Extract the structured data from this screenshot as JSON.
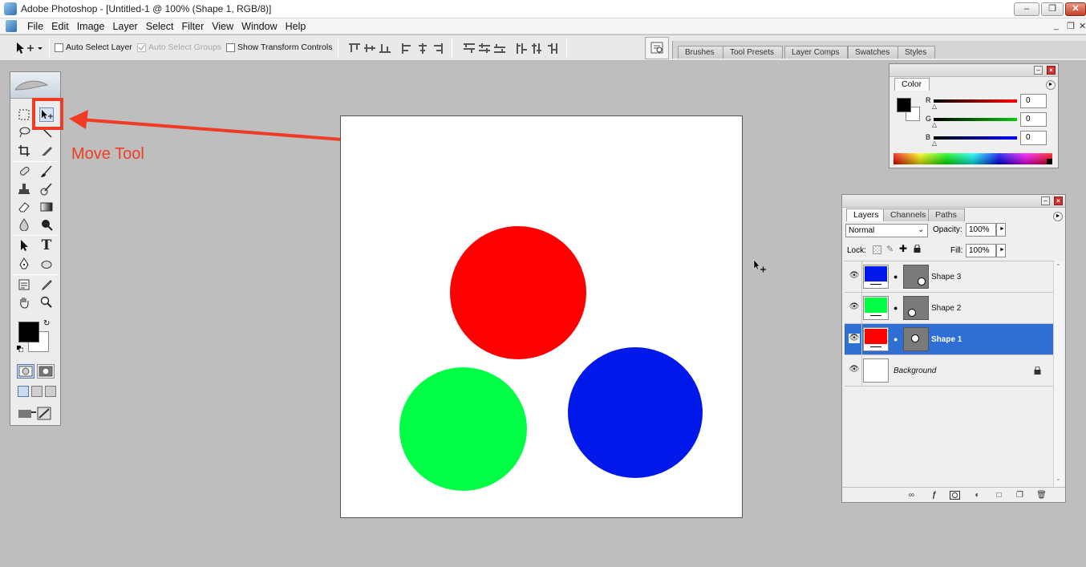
{
  "window": {
    "title": "Adobe Photoshop - [Untitled-1 @ 100% (Shape 1, RGB/8)]",
    "controls": [
      "–",
      "❐",
      "✕"
    ],
    "doc_controls": [
      "_",
      "❐",
      "✕"
    ]
  },
  "menu": [
    "File",
    "Edit",
    "Image",
    "Layer",
    "Select",
    "Filter",
    "View",
    "Window",
    "Help"
  ],
  "options": {
    "tool_preset_icon": "move-tool-icon",
    "auto_select_layer": "Auto Select Layer",
    "auto_select_groups": "Auto Select Groups",
    "show_transform_controls": "Show Transform Controls"
  },
  "wells": [
    "Brushes",
    "Tool Presets",
    "Layer Comps",
    "Swatches",
    "Styles"
  ],
  "annotation": {
    "label": "Move Tool",
    "color": "#ef3d25"
  },
  "canvas": {
    "circles": [
      {
        "name": "red-circle",
        "color": "#ff0000"
      },
      {
        "name": "green-circle",
        "color": "#00ff44"
      },
      {
        "name": "blue-circle",
        "color": "#0019ea"
      }
    ]
  },
  "color_panel": {
    "tab": "Color",
    "channels": [
      {
        "label": "R",
        "value": "0"
      },
      {
        "label": "G",
        "value": "0"
      },
      {
        "label": "B",
        "value": "0"
      }
    ]
  },
  "layers_panel": {
    "tabs": [
      "Layers",
      "Channels",
      "Paths"
    ],
    "blend_mode": "Normal",
    "opacity_label": "Opacity:",
    "opacity": "100%",
    "lock_label": "Lock:",
    "fill_label": "Fill:",
    "fill": "100%",
    "layers": [
      {
        "name": "Shape 3",
        "color": "#0019ea",
        "selected": false
      },
      {
        "name": "Shape 2",
        "color": "#00ff44",
        "selected": false
      },
      {
        "name": "Shape 1",
        "color": "#ff0000",
        "selected": true
      },
      {
        "name": "Background",
        "color": "#ffffff",
        "selected": false
      }
    ]
  }
}
